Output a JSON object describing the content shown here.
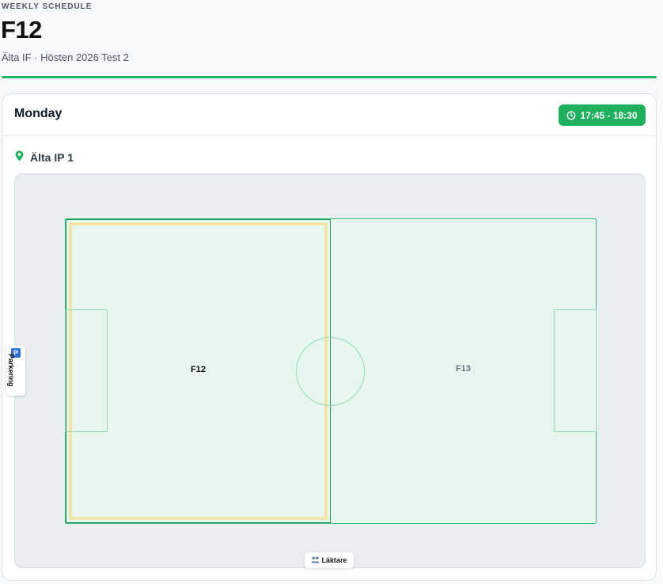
{
  "header": {
    "eyebrow": "WEEKLY SCHEDULE",
    "title": "F12",
    "subtitle": "Älta IF · Hösten 2026 Test 2"
  },
  "day": {
    "name": "Monday",
    "time": "17:45 - 18:30",
    "time_icon": "clock-icon"
  },
  "venue": {
    "icon": "map-pin-icon",
    "name": "Älta IP 1"
  },
  "pitch": {
    "zones": [
      {
        "label": "F12",
        "selected": true
      },
      {
        "label": "F13",
        "selected": false
      }
    ]
  },
  "amenities": {
    "parking": {
      "icon": "parking-icon",
      "icon_text": "P",
      "label": "Parkering"
    },
    "stand": {
      "icon": "people-icon",
      "label": "Läktare"
    }
  },
  "colors": {
    "accent": "#1fb05d",
    "field": "#e7f7ef",
    "selected_highlight": "#f0e5a5"
  }
}
